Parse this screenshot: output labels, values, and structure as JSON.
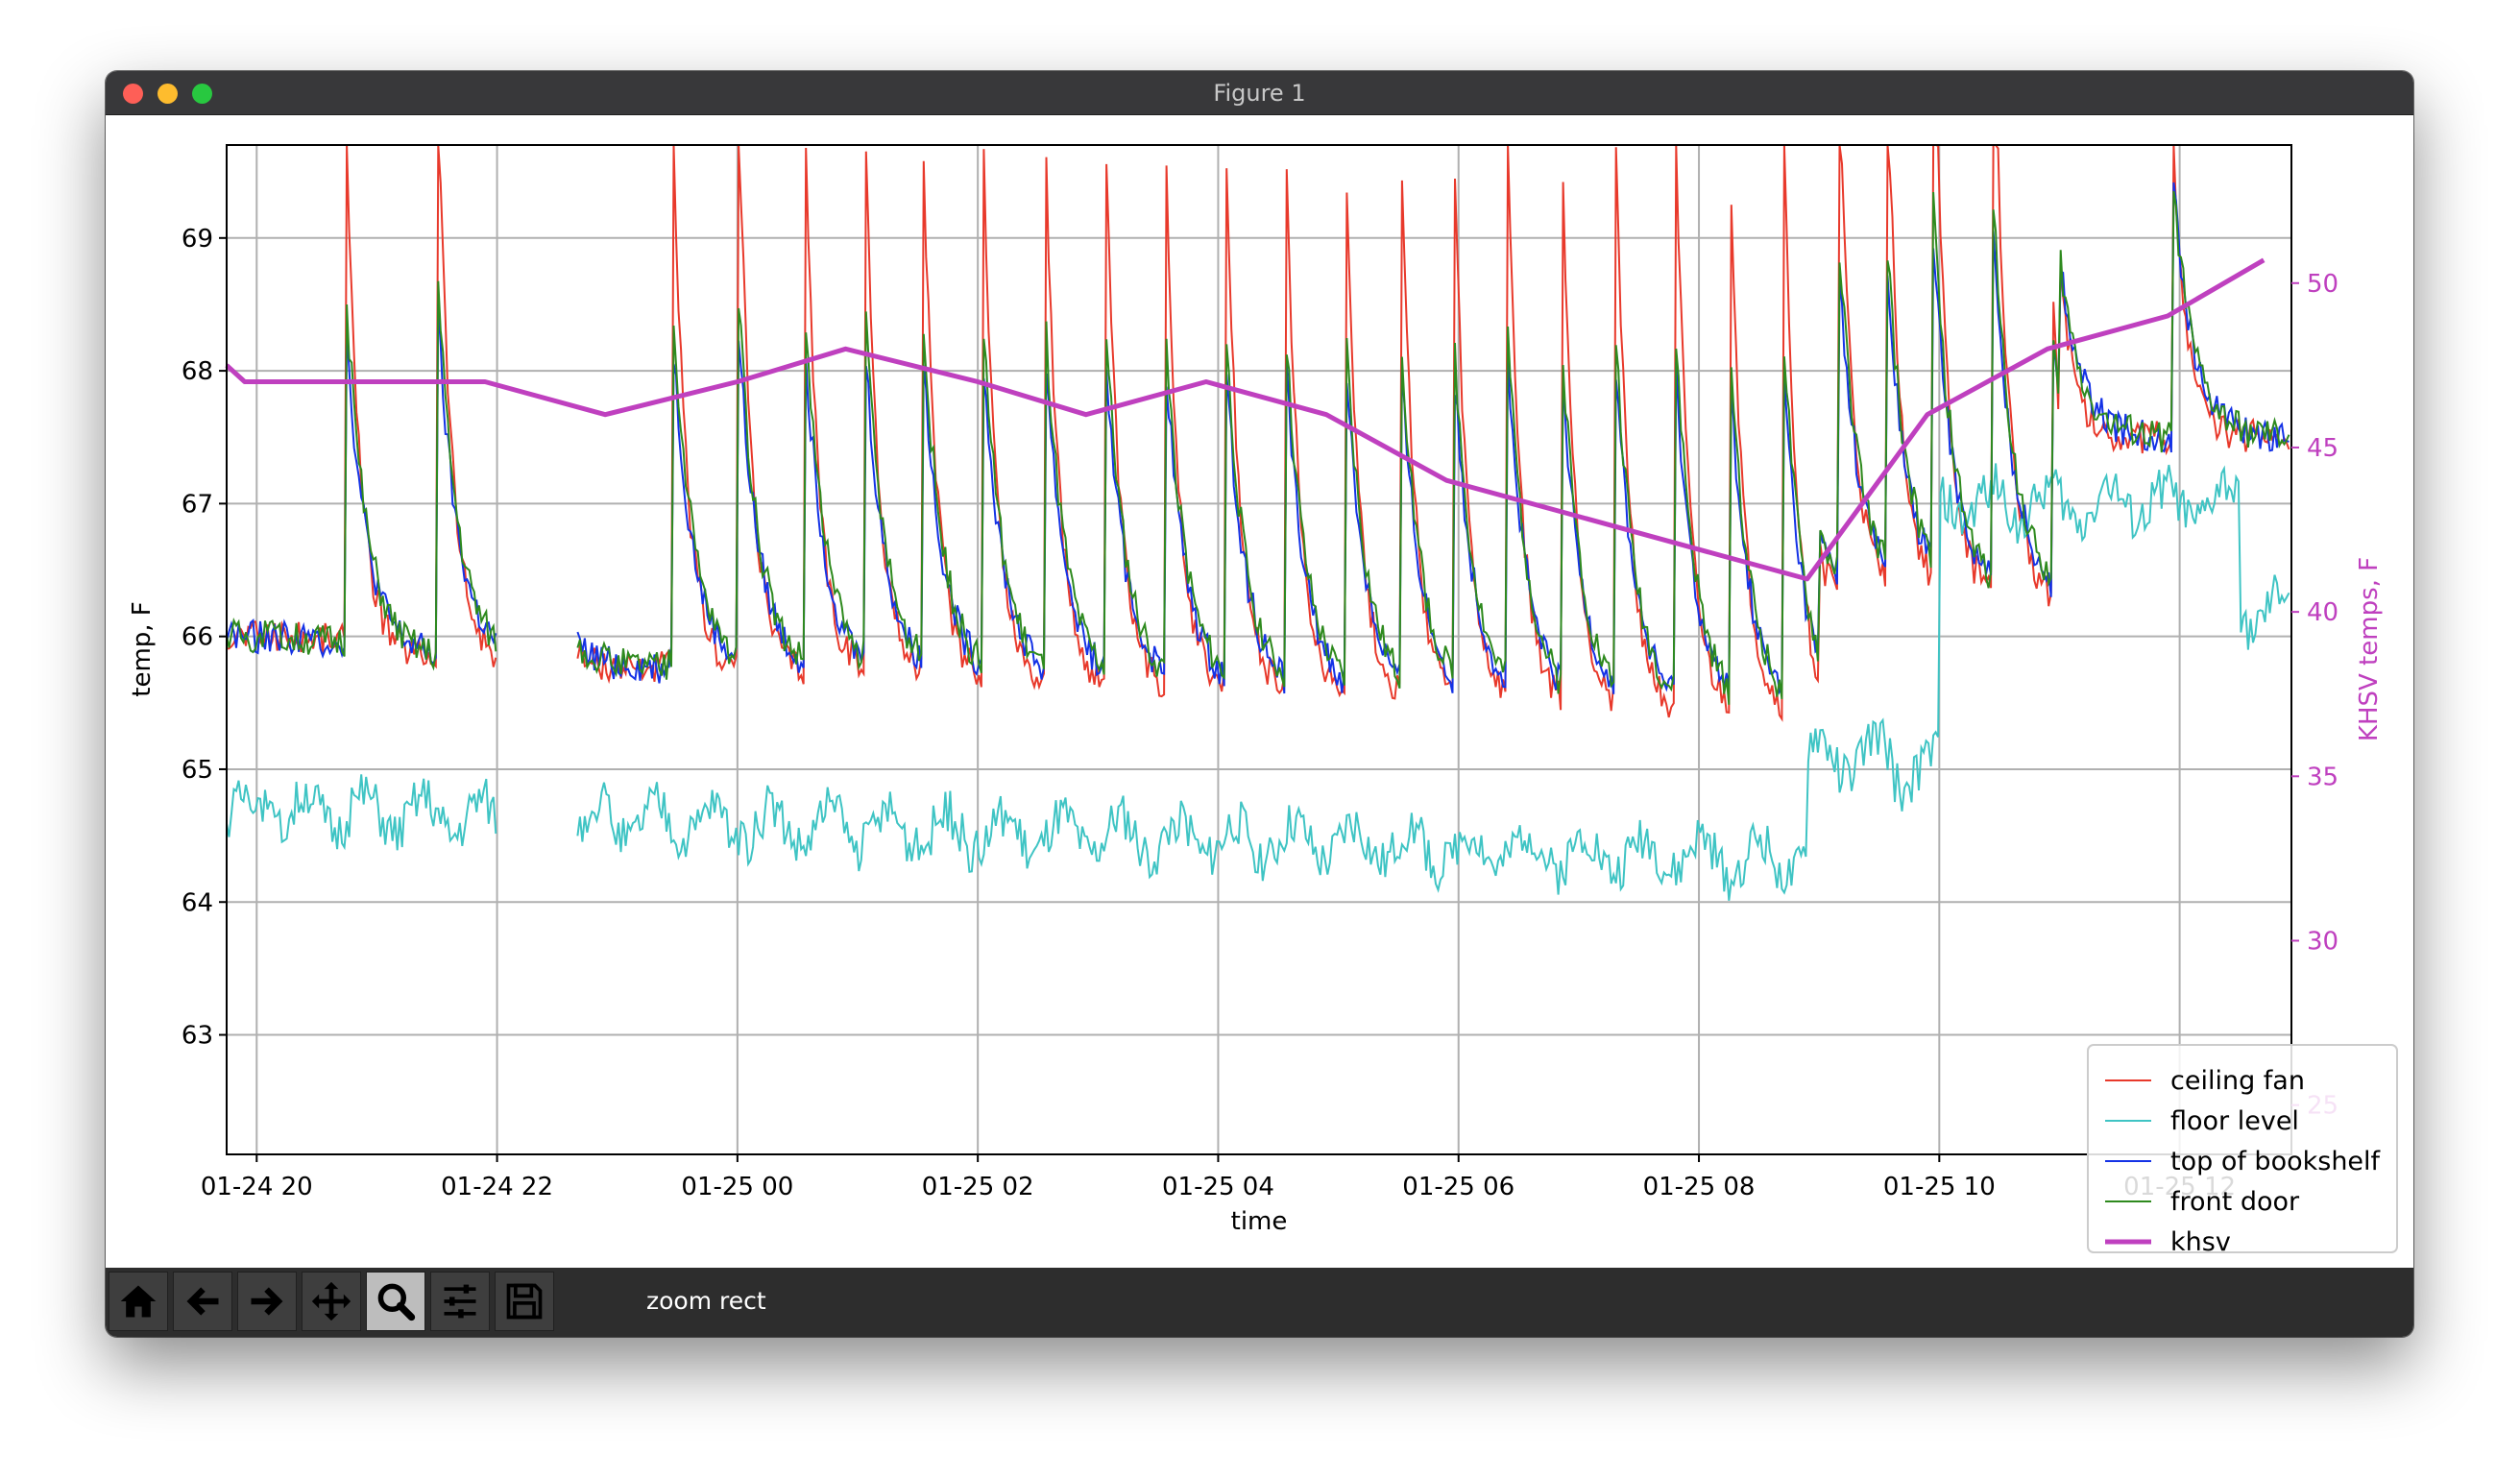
{
  "window": {
    "title": "Figure 1"
  },
  "toolbar": {
    "status": "zoom rect",
    "tools": [
      {
        "icon": "home-icon",
        "active": false
      },
      {
        "icon": "arrow-left-icon",
        "active": false
      },
      {
        "icon": "arrow-right-icon",
        "active": false
      },
      {
        "icon": "move-icon",
        "active": false
      },
      {
        "icon": "zoom-icon",
        "active": true
      },
      {
        "icon": "sliders-icon",
        "active": false
      },
      {
        "icon": "save-icon",
        "active": false
      }
    ]
  },
  "chart_data": {
    "type": "line",
    "xlabel": "time",
    "ylabel_left": "temp, F",
    "ylabel_right": "KHSV temps, F",
    "grid": true,
    "legend_placement": "bottom-right",
    "x_range_hours": [
      19.75,
      10.93
    ],
    "x_ticks": [
      {
        "label": "01-24 20",
        "hour": 20
      },
      {
        "label": "01-24 22",
        "hour": 22
      },
      {
        "label": "01-25 00",
        "hour": 24
      },
      {
        "label": "01-25 02",
        "hour": 26
      },
      {
        "label": "01-25 04",
        "hour": 28
      },
      {
        "label": "01-25 06",
        "hour": 30
      },
      {
        "label": "01-25 08",
        "hour": 32
      },
      {
        "label": "01-25 10",
        "hour": 34
      },
      {
        "label": "01-25 12",
        "hour": 36
      }
    ],
    "ylim_left": [
      62.1,
      69.7
    ],
    "y_ticks_left": [
      63,
      64,
      65,
      66,
      67,
      68,
      69
    ],
    "ylim_right": [
      23.5,
      54.2
    ],
    "y_ticks_right": [
      25,
      30,
      35,
      40,
      45,
      50
    ],
    "right_axis_color": "#bf40bf",
    "series": [
      {
        "name": "ceiling fan",
        "color": "#e8392b",
        "axis": "left"
      },
      {
        "name": "floor level",
        "color": "#3fc4c4",
        "axis": "left"
      },
      {
        "name": "top of bookshelf",
        "color": "#1432e6",
        "axis": "left"
      },
      {
        "name": "front door",
        "color": "#2e8a1e",
        "axis": "left"
      },
      {
        "name": "khsv",
        "color": "#bf40bf",
        "axis": "right",
        "width": "thick",
        "points": [
          [
            19.75,
            47.5
          ],
          [
            19.9,
            47.0
          ],
          [
            21.0,
            47.0
          ],
          [
            21.9,
            47.0
          ],
          [
            22.9,
            46.0
          ],
          [
            24.0,
            47.0
          ],
          [
            24.9,
            48.0
          ],
          [
            26.0,
            47.0
          ],
          [
            26.9,
            46.0
          ],
          [
            27.9,
            47.0
          ],
          [
            28.9,
            46.0
          ],
          [
            29.9,
            44.0
          ],
          [
            30.9,
            43.0
          ],
          [
            31.9,
            42.0
          ],
          [
            32.9,
            41.0
          ],
          [
            33.9,
            46.0
          ],
          [
            34.9,
            48.0
          ],
          [
            35.9,
            49.0
          ],
          [
            36.7,
            50.7
          ]
        ]
      }
    ]
  }
}
